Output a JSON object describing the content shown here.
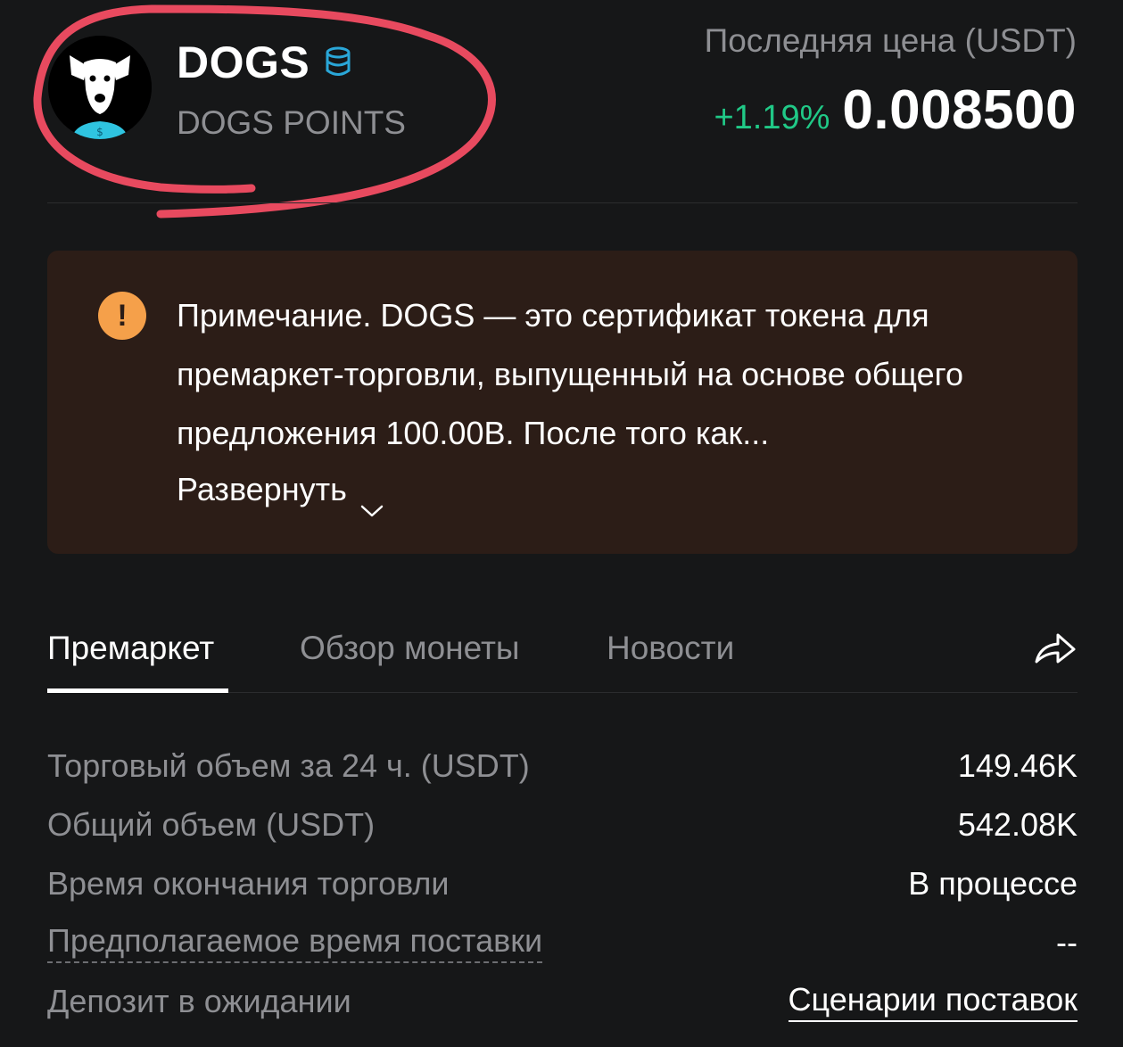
{
  "header": {
    "coin_symbol": "DOGS",
    "coin_name": "DOGS POINTS",
    "price_label": "Последняя цена (USDT)",
    "price_change": "+1.19%",
    "price_value": "0.008500",
    "badge_icon": "coin-stack-icon",
    "logo": "dogs-logo-icon"
  },
  "notice": {
    "icon": "exclamation-icon",
    "text": "Примечание. DOGS — это сертификат токена для премаркет-торговли, выпущенный на основе общего предложения 100.00B. После того как...",
    "expand_label": "Развернуть"
  },
  "tabs": [
    {
      "label": "Премаркет",
      "active": true
    },
    {
      "label": "Обзор монеты",
      "active": false
    },
    {
      "label": "Новости",
      "active": false
    }
  ],
  "share_icon": "share-icon",
  "stats": [
    {
      "label": "Торговый объем за 24 ч. (USDT)",
      "value": "149.46K"
    },
    {
      "label": "Общий объем (USDT)",
      "value": "542.08K"
    },
    {
      "label": "Время окончания торговли",
      "value": "В процессе"
    },
    {
      "label": "Предполагаемое время поставки",
      "value": "--"
    },
    {
      "label": "Депозит в ожидании",
      "value": "Сценарии поставок"
    }
  ],
  "colors": {
    "background": "#161718",
    "positive": "#20c987",
    "notice_bg": "#2c1d17",
    "warning": "#f5a04a",
    "muted_text": "#8e8f93",
    "annotation": "#e84a5f",
    "badge": "#2aa7d8"
  }
}
